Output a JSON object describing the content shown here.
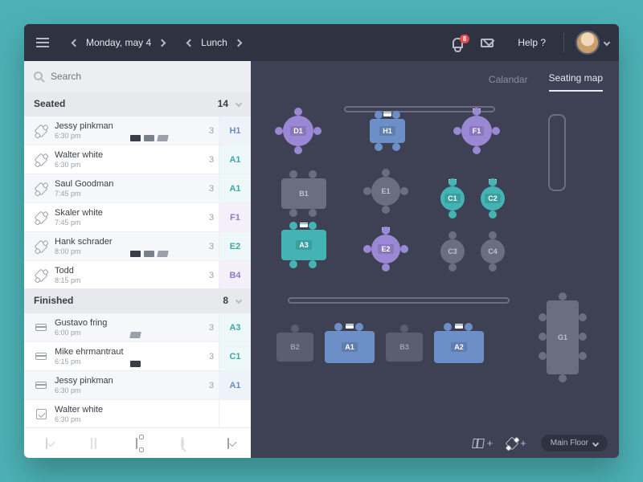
{
  "header": {
    "date": "Monday, may 4",
    "meal": "Lunch",
    "notifications": "8",
    "help": "Help ?"
  },
  "search": {
    "placeholder": "Search"
  },
  "tabs": {
    "calendar": "Calandar",
    "seating": "Seating map"
  },
  "sections": {
    "seated": {
      "title": "Seated",
      "count": "14"
    },
    "finished": {
      "title": "Finished",
      "count": "8"
    }
  },
  "seated": [
    {
      "name": "Jessy pinkman",
      "time": "6:30 pm",
      "party": "3",
      "table": "H1",
      "tclass": "blue",
      "tags": [
        "pct",
        "card",
        "note"
      ]
    },
    {
      "name": "Walter white",
      "time": "6:30 pm",
      "party": "3",
      "table": "A1",
      "tclass": "teal",
      "tags": []
    },
    {
      "name": "Saul Goodman",
      "time": "7:45 pm",
      "party": "3",
      "table": "A1",
      "tclass": "teal",
      "tags": []
    },
    {
      "name": "Skaler white",
      "time": "7:45 pm",
      "party": "3",
      "table": "F1",
      "tclass": "purple",
      "tags": []
    },
    {
      "name": "Hank schrader",
      "time": "8:00 pm",
      "party": "3",
      "table": "E2",
      "tclass": "teal",
      "tags": [
        "pct",
        "card",
        "note"
      ]
    },
    {
      "name": "Todd",
      "time": "8:15 pm",
      "party": "3",
      "table": "B4",
      "tclass": "purple",
      "tags": []
    }
  ],
  "finished": [
    {
      "name": "Gustavo fring",
      "time": "6:00 pm",
      "party": "3",
      "table": "A3",
      "tclass": "teal",
      "icon": "card",
      "tags": [
        "note"
      ]
    },
    {
      "name": "Mike ehrmantraut",
      "time": "6:15 pm",
      "party": "3",
      "table": "C1",
      "tclass": "teal",
      "icon": "card",
      "tags": [
        "pct"
      ]
    },
    {
      "name": "Jessy pinkman",
      "time": "6:30 pm",
      "party": "3",
      "table": "A1",
      "tclass": "blue",
      "icon": "card",
      "tags": []
    },
    {
      "name": "Walter white",
      "time": "6:30 pm",
      "party": "",
      "table": "",
      "tclass": "",
      "icon": "check",
      "tags": []
    }
  ],
  "floor": {
    "label": "Main Floor"
  },
  "tables": {
    "D1": "D1",
    "H1": "H1",
    "F1": "F1",
    "B1": "B1",
    "E1": "E1",
    "C1": "C1",
    "C2": "C2",
    "A3": "A3",
    "E2": "E2",
    "C3": "C3",
    "C4": "C4",
    "B2": "B2",
    "A1": "A1",
    "B3": "B3",
    "A2": "A2",
    "G1": "G1"
  }
}
